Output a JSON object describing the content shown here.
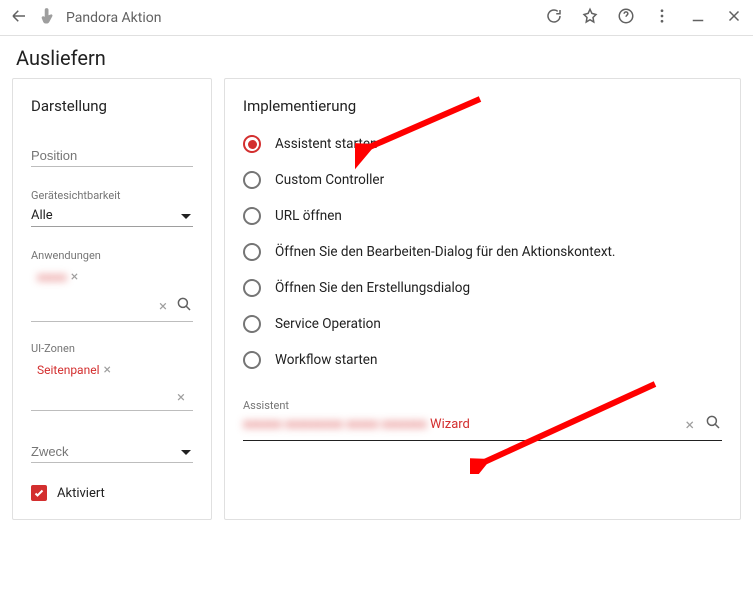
{
  "header": {
    "app_title": "Pandora Aktion",
    "page_title": "Ausliefern"
  },
  "sidebar": {
    "heading": "Darstellung",
    "position_placeholder": "Position",
    "device_visibility_label": "Gerätesichtbarkeit",
    "device_visibility_value": "Alle",
    "applications_label": "Anwendungen",
    "application_chip": "xxxxx",
    "uizones_label": "UI-Zonen",
    "uizone_chip": "Seitenpanel",
    "purpose_placeholder": "Zweck",
    "activated_label": "Aktiviert"
  },
  "main": {
    "heading": "Implementierung",
    "options": [
      "Assistent starten",
      "Custom Controller",
      "URL öffnen",
      "Öffnen Sie den Bearbeiten-Dialog für den Aktionskontext.",
      "Öffnen Sie den Erstellungsdialog",
      "Service Operation",
      "Workflow starten"
    ],
    "selected_index": 0,
    "wizard_label": "Assistent",
    "wizard_value_redacted": "xxxxxx xxxxxxxxx xxxxx xxxxxxx",
    "wizard_value_visible": "Wizard"
  }
}
